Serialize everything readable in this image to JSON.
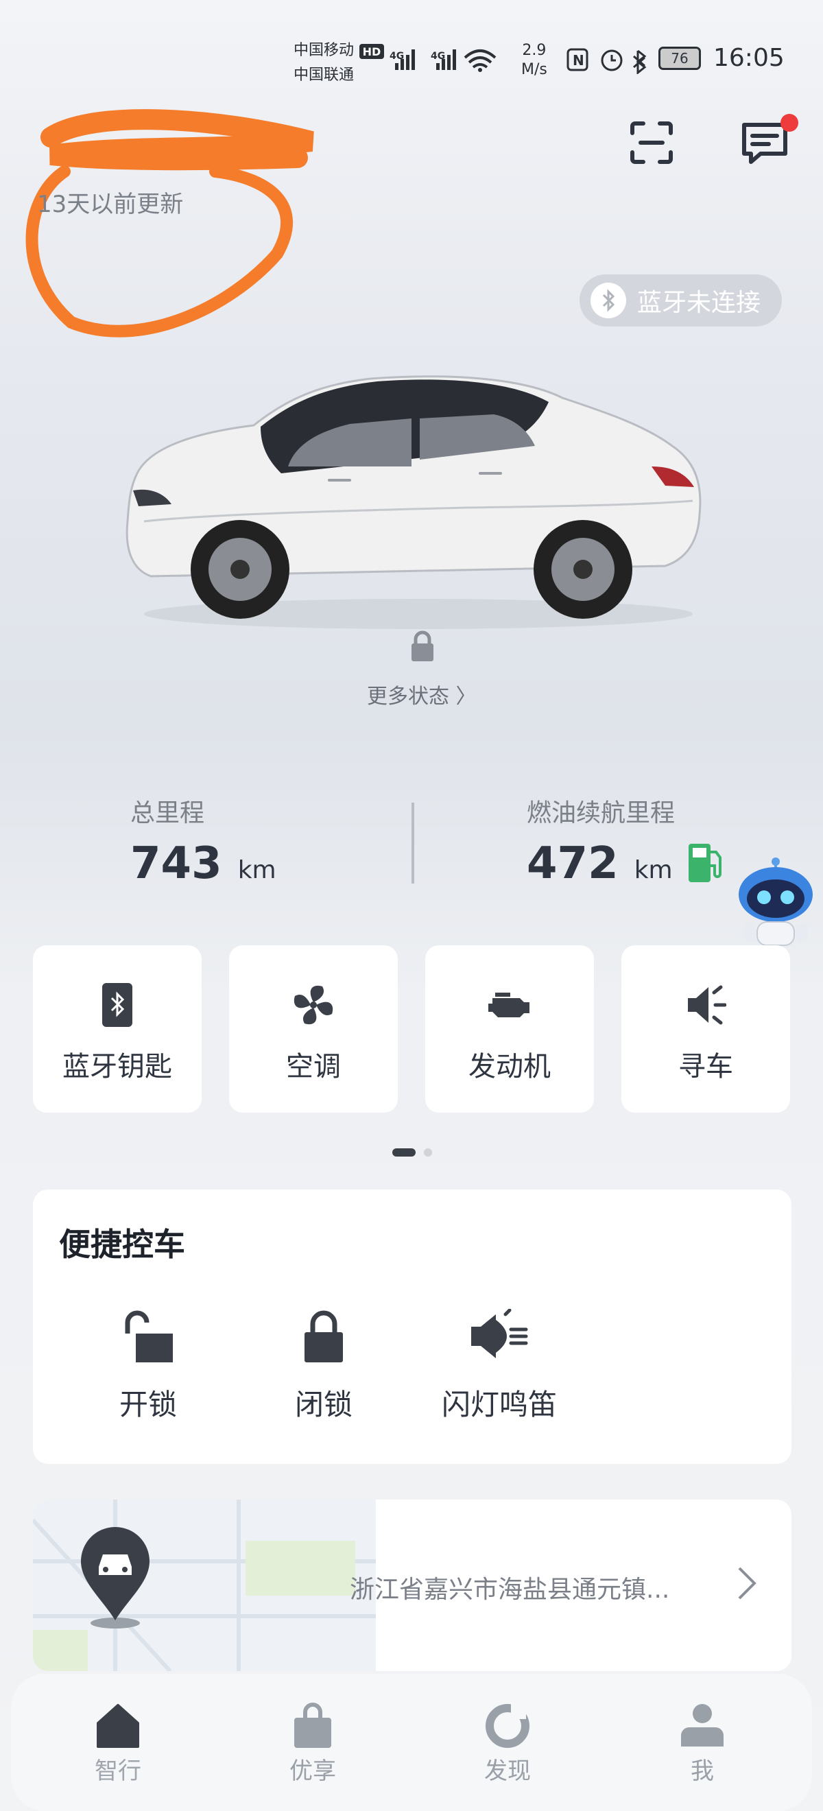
{
  "status_bar": {
    "carrier_1": "中国移动",
    "carrier_2": "中国联通",
    "hd": "HD",
    "net_speed_value": "2.9",
    "net_speed_unit": "M/s",
    "battery": "76",
    "time": "16:05"
  },
  "header": {
    "updated": "13天以前更新",
    "bluetooth_status": "蓝牙未连接"
  },
  "vehicle": {
    "more_status": "更多状态 〉"
  },
  "mileage": {
    "total_label": "总里程",
    "total_value": "743",
    "total_unit": "km",
    "range_label": "燃油续航里程",
    "range_value": "472",
    "range_unit": "km"
  },
  "quick_actions": [
    {
      "label": "蓝牙钥匙",
      "icon": "bluetooth-key-icon"
    },
    {
      "label": "空调",
      "icon": "fan-icon"
    },
    {
      "label": "发动机",
      "icon": "engine-icon"
    },
    {
      "label": "寻车",
      "icon": "horn-icon"
    }
  ],
  "control": {
    "title": "便捷控车",
    "items": [
      {
        "label": "开锁",
        "icon": "unlock-icon"
      },
      {
        "label": "闭锁",
        "icon": "lock-icon"
      },
      {
        "label": "闪灯鸣笛",
        "icon": "flash-horn-icon"
      }
    ]
  },
  "location": {
    "address": "浙江省嘉兴市海盐县通元镇..."
  },
  "nav": [
    {
      "label": "智行",
      "icon": "home-icon"
    },
    {
      "label": "优享",
      "icon": "shopping-bag-icon"
    },
    {
      "label": "发现",
      "icon": "discover-icon"
    },
    {
      "label": "我",
      "icon": "person-icon"
    }
  ],
  "colors": {
    "accent_dark": "#2f3540",
    "redaction": "#f47c2a",
    "notification": "#ee3b3b",
    "fuel_green": "#3bb36a"
  }
}
